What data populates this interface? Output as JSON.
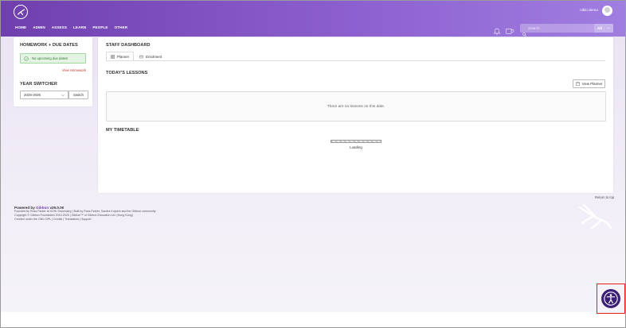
{
  "header": {
    "nav": [
      "HOME",
      "ADMIN",
      "ASSESS",
      "LEARN",
      "PEOPLE",
      "OTHER"
    ],
    "user_name": "nikki demo",
    "search": {
      "placeholder": "Search",
      "scope": "All"
    }
  },
  "sidebar": {
    "homework_title": "HOMEWORK + DUE DATES",
    "homework_alert": "No upcoming due dates!",
    "view_homework": "View Homework",
    "year_switcher_title": "YEAR SWITCHER",
    "year_selected": "2025-2026",
    "switch_label": "Switch"
  },
  "main": {
    "title": "STAFF DASHBOARD",
    "tabs": [
      "Planner",
      "Enrolment"
    ],
    "lessons_title": "TODAY'S LESSONS",
    "view_planner": "View Planner",
    "no_lessons": "There are no lessons on this date.",
    "timetable_title": "MY TIMETABLE",
    "loading": "Loading"
  },
  "footer": {
    "return_top": "Return to top",
    "powered_prefix": "Powered by",
    "powered_link": "Gibbon",
    "powered_version": "v29.0.00",
    "lines": [
      "Founded by Ross Parker at ICHK Secondary | Built by Ross Parker, Sandra Kuipers and the Gibbon community",
      "Copyright © Gibbon Foundation 2010-2025 | Gibbon™ of Gibbon Education Ltd. (Hong Kong)",
      "Created under the GNU GPL | Credits | Translators | Support"
    ]
  },
  "colors": {
    "brand_purple": "#6f3fae",
    "accessibility_button": "#3b1f73",
    "highlight_red": "#e02020",
    "alert_green": "#e3f5e2"
  }
}
